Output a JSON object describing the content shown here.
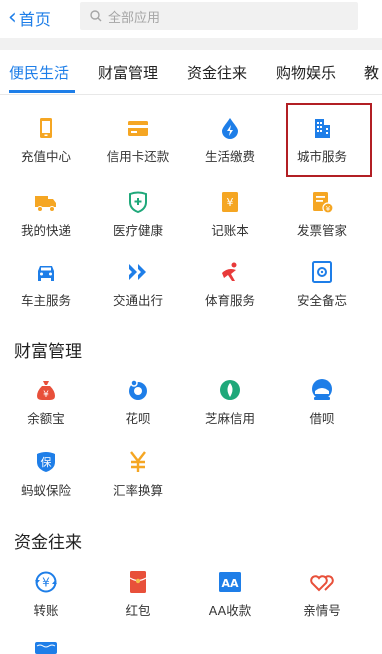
{
  "header": {
    "back_label": "首页",
    "search_placeholder": "全部应用"
  },
  "tabs": [
    {
      "label": "便民生活",
      "active": true
    },
    {
      "label": "财富管理",
      "active": false
    },
    {
      "label": "资金往来",
      "active": false
    },
    {
      "label": "购物娱乐",
      "active": false
    },
    {
      "label": "教",
      "active": false
    }
  ],
  "sections": [
    {
      "title": "",
      "items": [
        {
          "label": "充值中心",
          "icon": "phone-recharge-icon",
          "color": "#f5a623"
        },
        {
          "label": "信用卡还款",
          "icon": "credit-card-icon",
          "color": "#f5a623"
        },
        {
          "label": "生活缴费",
          "icon": "water-drop-bolt-icon",
          "color": "#1e7ee8"
        },
        {
          "label": "城市服务",
          "icon": "city-building-icon",
          "color": "#1e7ee8",
          "highlighted": true
        },
        {
          "label": "我的快递",
          "icon": "truck-icon",
          "color": "#f5a623"
        },
        {
          "label": "医疗健康",
          "icon": "health-shield-icon",
          "color": "#1fa87a"
        },
        {
          "label": "记账本",
          "icon": "ledger-book-icon",
          "color": "#f5a623"
        },
        {
          "label": "发票管家",
          "icon": "invoice-icon",
          "color": "#f5a623"
        },
        {
          "label": "车主服务",
          "icon": "car-icon",
          "color": "#1e7ee8"
        },
        {
          "label": "交通出行",
          "icon": "double-chevron-icon",
          "color": "#1e7ee8"
        },
        {
          "label": "体育服务",
          "icon": "sports-runner-icon",
          "color": "#e83a3a"
        },
        {
          "label": "安全备忘",
          "icon": "safe-memo-icon",
          "color": "#1e7ee8"
        }
      ]
    },
    {
      "title": "财富管理",
      "items": [
        {
          "label": "余额宝",
          "icon": "money-bag-icon",
          "color": "#e8503a"
        },
        {
          "label": "花呗",
          "icon": "huabei-icon",
          "color": "#1e7ee8"
        },
        {
          "label": "芝麻信用",
          "icon": "sesame-credit-icon",
          "color": "#1fa87a"
        },
        {
          "label": "借呗",
          "icon": "jiebei-icon",
          "color": "#1e7ee8"
        },
        {
          "label": "蚂蚁保险",
          "icon": "insurance-shield-icon",
          "color": "#1e7ee8"
        },
        {
          "label": "汇率换算",
          "icon": "yen-exchange-icon",
          "color": "#f5a623"
        }
      ]
    },
    {
      "title": "资金往来",
      "items": [
        {
          "label": "转账",
          "icon": "transfer-yen-icon",
          "color": "#1e7ee8"
        },
        {
          "label": "红包",
          "icon": "red-envelope-icon",
          "color": "#e8503a"
        },
        {
          "label": "AA收款",
          "icon": "aa-collect-icon",
          "color": "#1e7ee8"
        },
        {
          "label": "亲情号",
          "icon": "family-hearts-icon",
          "color": "#e8503a"
        }
      ]
    }
  ]
}
